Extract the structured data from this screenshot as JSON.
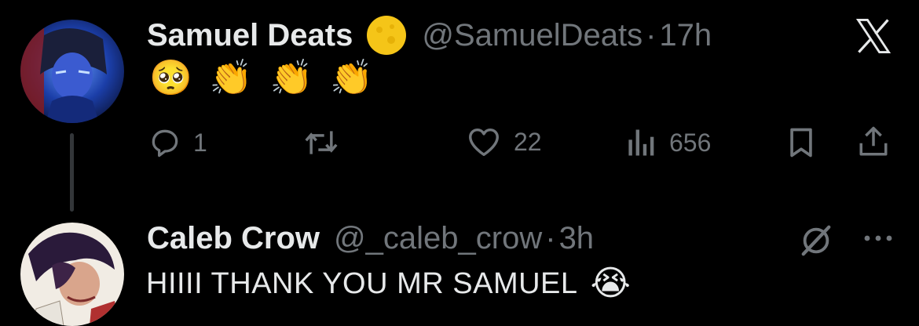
{
  "tweets": [
    {
      "author_name": "Samuel Deats",
      "handle": "@SamuelDeats",
      "separator": "·",
      "time": "17h",
      "badge_icon": "gold-verified-circle-icon",
      "body_emojis": [
        "🥺",
        "👏",
        "👏",
        "👏"
      ],
      "actions": {
        "reply_count": "1",
        "retweet_count": "",
        "like_count": "22",
        "views_count": "656"
      }
    },
    {
      "author_name": "Caleb Crow",
      "handle": "@_caleb_crow",
      "separator": "·",
      "time": "3h",
      "body_text": "HIIII THANK YOU MR SAMUEL",
      "body_emoji": "😭"
    }
  ],
  "header_icons": {
    "close": "x-logo-icon",
    "grok": "grok-icon",
    "more": "more-dots-icon"
  },
  "colors": {
    "background": "#000000",
    "text": "#e7e9ea",
    "secondary": "#71767b",
    "badge": "#f5c518"
  }
}
